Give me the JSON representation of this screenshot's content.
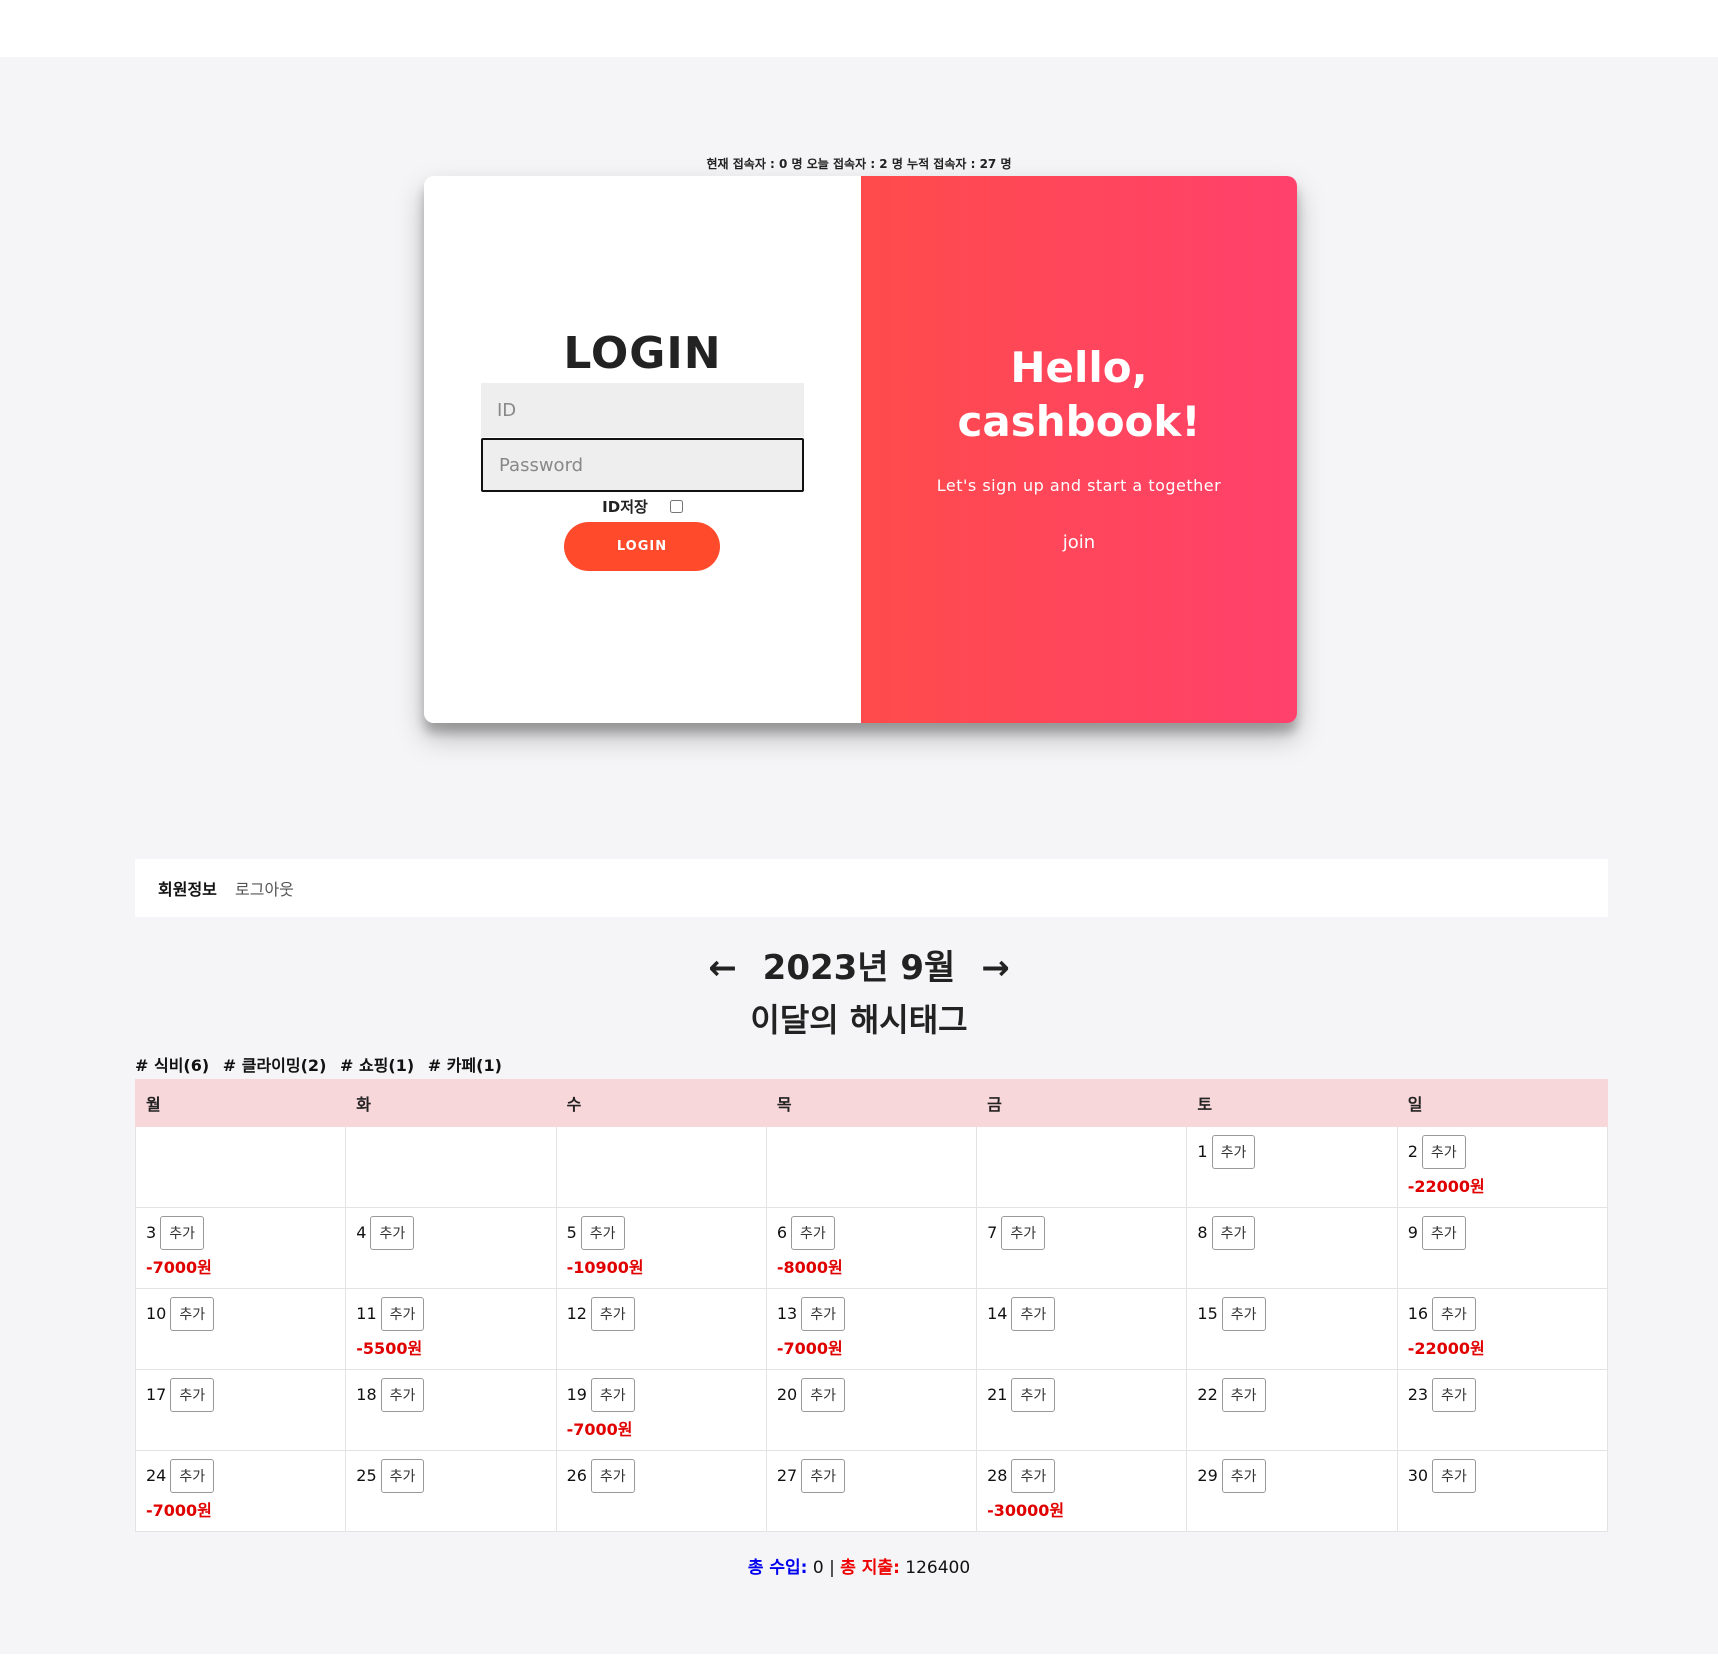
{
  "visitors": "현재 접속자 : 0 명 오늘 접속자 : 2 명 누적 접속자 : 27 명",
  "login": {
    "title": "LOGIN",
    "id_placeholder": "ID",
    "password_placeholder": "Password",
    "remember_label": "ID저장",
    "button_label": "LOGIN"
  },
  "welcome": {
    "line1": "Hello,",
    "line2": "cashbook!",
    "tagline": "Let's sign up and start a together",
    "join_label": "join"
  },
  "colors": {
    "gradient_start": "#ff4b4b",
    "gradient_end": "#ff416c",
    "login_button": "#ff4b2b",
    "header_row": "#f8d7da",
    "expense_red": "#e00000"
  },
  "nav": {
    "member_info": "회원정보",
    "logout": "로그아웃"
  },
  "calendar": {
    "prev_arrow": "←",
    "month_label": "2023년 9월",
    "next_arrow": "→",
    "hashtag_title": "이달의 해시태그",
    "hashtags": [
      "# 식비(6)",
      "# 클라이밍(2)",
      "# 쇼핑(1)",
      "# 카페(1)"
    ],
    "weekdays": [
      "월",
      "화",
      "수",
      "목",
      "금",
      "토",
      "일"
    ],
    "add_label": "추가",
    "weeks": [
      [
        null,
        null,
        null,
        null,
        null,
        {
          "day": "1",
          "amount": ""
        },
        {
          "day": "2",
          "amount": "-22000원"
        }
      ],
      [
        {
          "day": "3",
          "amount": "-7000원"
        },
        {
          "day": "4",
          "amount": ""
        },
        {
          "day": "5",
          "amount": "-10900원"
        },
        {
          "day": "6",
          "amount": "-8000원"
        },
        {
          "day": "7",
          "amount": ""
        },
        {
          "day": "8",
          "amount": ""
        },
        {
          "day": "9",
          "amount": ""
        }
      ],
      [
        {
          "day": "10",
          "amount": ""
        },
        {
          "day": "11",
          "amount": "-5500원"
        },
        {
          "day": "12",
          "amount": ""
        },
        {
          "day": "13",
          "amount": "-7000원"
        },
        {
          "day": "14",
          "amount": ""
        },
        {
          "day": "15",
          "amount": ""
        },
        {
          "day": "16",
          "amount": "-22000원"
        }
      ],
      [
        {
          "day": "17",
          "amount": ""
        },
        {
          "day": "18",
          "amount": ""
        },
        {
          "day": "19",
          "amount": "-7000원"
        },
        {
          "day": "20",
          "amount": ""
        },
        {
          "day": "21",
          "amount": ""
        },
        {
          "day": "22",
          "amount": ""
        },
        {
          "day": "23",
          "amount": ""
        }
      ],
      [
        {
          "day": "24",
          "amount": "-7000원"
        },
        {
          "day": "25",
          "amount": ""
        },
        {
          "day": "26",
          "amount": ""
        },
        {
          "day": "27",
          "amount": ""
        },
        {
          "day": "28",
          "amount": "-30000원"
        },
        {
          "day": "29",
          "amount": ""
        },
        {
          "day": "30",
          "amount": ""
        }
      ]
    ]
  },
  "totals": {
    "income_label": "총 수입:",
    "income_value": "0",
    "separator": "|",
    "expense_label": "총 지출:",
    "expense_value": "126400"
  }
}
